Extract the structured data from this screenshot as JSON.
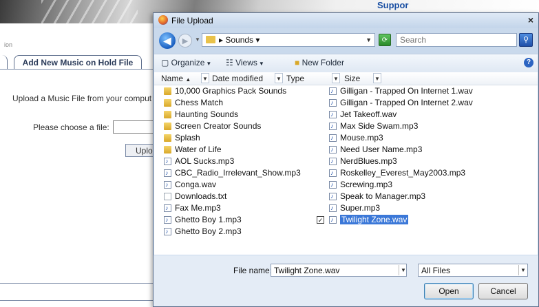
{
  "background": {
    "banner_text": "Suppor",
    "section_label": "ion",
    "tab_label": "Add New Music on Hold File",
    "upload_text": "Upload a Music File from your comput",
    "choose_label": "Please choose a file:",
    "upload_button": "Uplo"
  },
  "dialog": {
    "title": "File Upload",
    "close": "×",
    "address": "Sounds",
    "search_placeholder": "Search",
    "toolbar": {
      "organize": "Organize",
      "views": "Views",
      "new_folder": "New Folder"
    },
    "columns": [
      "Name",
      "Date modified",
      "Type",
      "Size"
    ],
    "files_left": [
      {
        "name": "10,000 Graphics Pack Sounds",
        "kind": "folder"
      },
      {
        "name": "Chess Match",
        "kind": "folder"
      },
      {
        "name": "Haunting Sounds",
        "kind": "folder"
      },
      {
        "name": "Screen Creator Sounds",
        "kind": "folder"
      },
      {
        "name": "Splash",
        "kind": "folder"
      },
      {
        "name": "Water of Life",
        "kind": "folder"
      },
      {
        "name": "AOL Sucks.mp3",
        "kind": "audio"
      },
      {
        "name": "CBC_Radio_Irrelevant_Show.mp3",
        "kind": "audio"
      },
      {
        "name": "Conga.wav",
        "kind": "audio"
      },
      {
        "name": "Downloads.txt",
        "kind": "text"
      },
      {
        "name": "Fax Me.mp3",
        "kind": "audio"
      },
      {
        "name": "Ghetto Boy 1.mp3",
        "kind": "audio"
      },
      {
        "name": "Ghetto Boy 2.mp3",
        "kind": "audio"
      }
    ],
    "files_right": [
      {
        "name": "Gilligan - Trapped On Internet 1.wav",
        "kind": "audio"
      },
      {
        "name": "Gilligan - Trapped On Internet 2.wav",
        "kind": "audio"
      },
      {
        "name": "Jet Takeoff.wav",
        "kind": "audio"
      },
      {
        "name": "Max Side Swam.mp3",
        "kind": "audio"
      },
      {
        "name": "Mouse.mp3",
        "kind": "audio"
      },
      {
        "name": "Need User Name.mp3",
        "kind": "audio"
      },
      {
        "name": "NerdBlues.mp3",
        "kind": "audio"
      },
      {
        "name": "Roskelley_Everest_May2003.mp3",
        "kind": "audio"
      },
      {
        "name": "Screwing.mp3",
        "kind": "audio"
      },
      {
        "name": "Speak to Manager.mp3",
        "kind": "audio"
      },
      {
        "name": "Super.mp3",
        "kind": "audio"
      },
      {
        "name": "Twilight Zone.wav",
        "kind": "audio",
        "selected": true
      }
    ],
    "file_name_label": "File name:",
    "file_name_value": "Twilight Zone.wav",
    "filter_value": "All Files",
    "open_button": "Open",
    "cancel_button": "Cancel"
  }
}
